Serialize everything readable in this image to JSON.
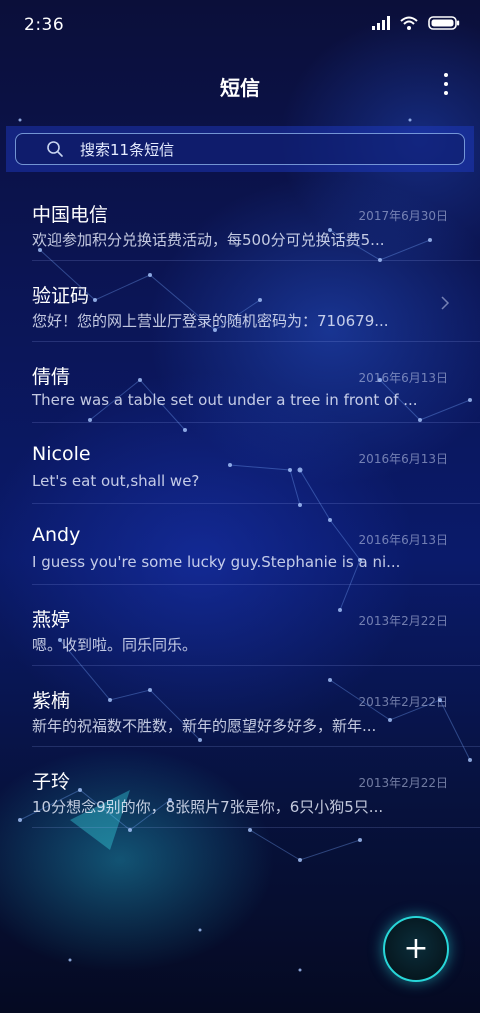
{
  "status_bar": {
    "time": "2:36"
  },
  "header": {
    "title": "短信"
  },
  "search": {
    "placeholder": "搜索11条短信"
  },
  "conversations": [
    {
      "name": "中国电信",
      "date": "2017年6月30日",
      "snippet": "欢迎参加积分兑换话费活动，每500分可兑换话费5..."
    },
    {
      "name": "验证码",
      "date": "",
      "snippet": "您好！您的网上营业厅登录的随机密码为：710679..."
    },
    {
      "name": "倩倩",
      "date": "2016年6月13日",
      "snippet": "There was a table set out under a tree in front of ..."
    },
    {
      "name": "Nicole",
      "date": "2016年6月13日",
      "snippet": "Let's eat out,shall we?"
    },
    {
      "name": "Andy",
      "date": "2016年6月13日",
      "snippet": "I guess you're some lucky guy.Stephanie is a ni..."
    },
    {
      "name": "燕婷",
      "date": "2013年2月22日",
      "snippet": "嗯。收到啦。同乐同乐。"
    },
    {
      "name": "紫楠",
      "date": "2013年2月22日",
      "snippet": "新年的祝福数不胜数，新年的愿望好多好多，新年..."
    },
    {
      "name": "子玲",
      "date": "2013年2月22日",
      "snippet": "10分想念9别的你，8张照片7张是你，6只小狗5只..."
    }
  ],
  "fab": {
    "label": "+"
  },
  "colors": {
    "accent": "#28d6d8",
    "background": "#0b1556"
  },
  "icons": {
    "signal": "signal-icon",
    "wifi": "wifi-icon",
    "battery": "battery-icon",
    "more": "more-vertical-icon",
    "search": "search-icon",
    "chevron": "chevron-right-icon",
    "compose": "plus-icon"
  }
}
